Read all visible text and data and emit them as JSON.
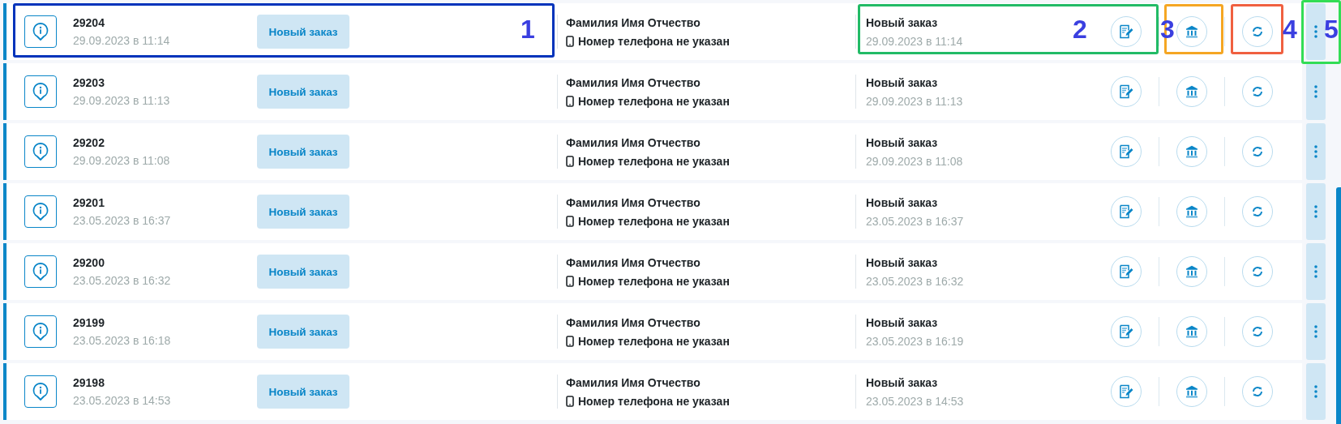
{
  "orders": [
    {
      "number": "29204",
      "created": "29.09.2023 в 11:14",
      "badge": "Новый заказ",
      "client_name": "Фамилия Имя Отчество",
      "phone": "Номер телефона не указан",
      "status": "Новый заказ",
      "status_date": "29.09.2023 в 11:14"
    },
    {
      "number": "29203",
      "created": "29.09.2023 в 11:13",
      "badge": "Новый заказ",
      "client_name": "Фамилия Имя Отчество",
      "phone": "Номер телефона не указан",
      "status": "Новый заказ",
      "status_date": "29.09.2023 в 11:13"
    },
    {
      "number": "29202",
      "created": "29.09.2023 в 11:08",
      "badge": "Новый заказ",
      "client_name": "Фамилия Имя Отчество",
      "phone": "Номер телефона не указан",
      "status": "Новый заказ",
      "status_date": "29.09.2023 в 11:08"
    },
    {
      "number": "29201",
      "created": "23.05.2023 в 16:37",
      "badge": "Новый заказ",
      "client_name": "Фамилия Имя Отчество",
      "phone": "Номер телефона не указан",
      "status": "Новый заказ",
      "status_date": "23.05.2023 в 16:37"
    },
    {
      "number": "29200",
      "created": "23.05.2023 в 16:32",
      "badge": "Новый заказ",
      "client_name": "Фамилия Имя Отчество",
      "phone": "Номер телефона не указан",
      "status": "Новый заказ",
      "status_date": "23.05.2023 в 16:32"
    },
    {
      "number": "29199",
      "created": "23.05.2023 в 16:18",
      "badge": "Новый заказ",
      "client_name": "Фамилия Имя Отчество",
      "phone": "Номер телефона не указан",
      "status": "Новый заказ",
      "status_date": "23.05.2023 в 16:19"
    },
    {
      "number": "29198",
      "created": "23.05.2023 в 14:53",
      "badge": "Новый заказ",
      "client_name": "Фамилия Имя Отчество",
      "phone": "Номер телефона не указан",
      "status": "Новый заказ",
      "status_date": "23.05.2023 в 14:53"
    }
  ],
  "annotations": [
    {
      "label": "1",
      "kind": "order",
      "color": "#0033bb"
    },
    {
      "label": "2",
      "kind": "status",
      "color": "#22bb66"
    },
    {
      "label": "3",
      "kind": "requisites",
      "color": "#f5a623"
    },
    {
      "label": "4",
      "kind": "refresh",
      "color": "#f06040"
    },
    {
      "label": "5",
      "kind": "menu",
      "color": "#33dd55"
    }
  ]
}
